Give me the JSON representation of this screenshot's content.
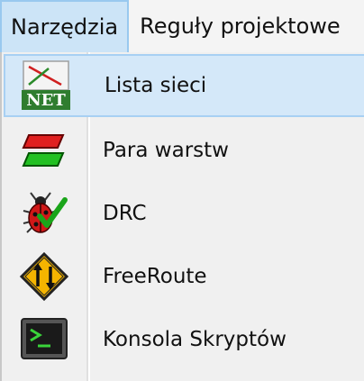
{
  "menubar": {
    "menus": [
      {
        "label": "Narzędzia",
        "active": true
      },
      {
        "label": "Reguły projektowe",
        "active": false
      }
    ]
  },
  "dropdown": {
    "items": [
      {
        "label": "Lista sieci",
        "icon": "netlist-icon",
        "highlighted": true
      },
      {
        "label": "Para warstw",
        "icon": "layer-pair-icon",
        "highlighted": false
      },
      {
        "label": "DRC",
        "icon": "drc-bug-icon",
        "highlighted": false
      },
      {
        "label": "FreeRoute",
        "icon": "freeroute-sign-icon",
        "highlighted": false
      },
      {
        "label": "Konsola Skryptów",
        "icon": "script-console-icon",
        "highlighted": false
      }
    ],
    "netlist_icon_text": "NET"
  },
  "colors": {
    "highlight_bg": "#d4e8f9",
    "highlight_border": "#a8d0f3",
    "menu_active_bg": "#cce4f7"
  }
}
